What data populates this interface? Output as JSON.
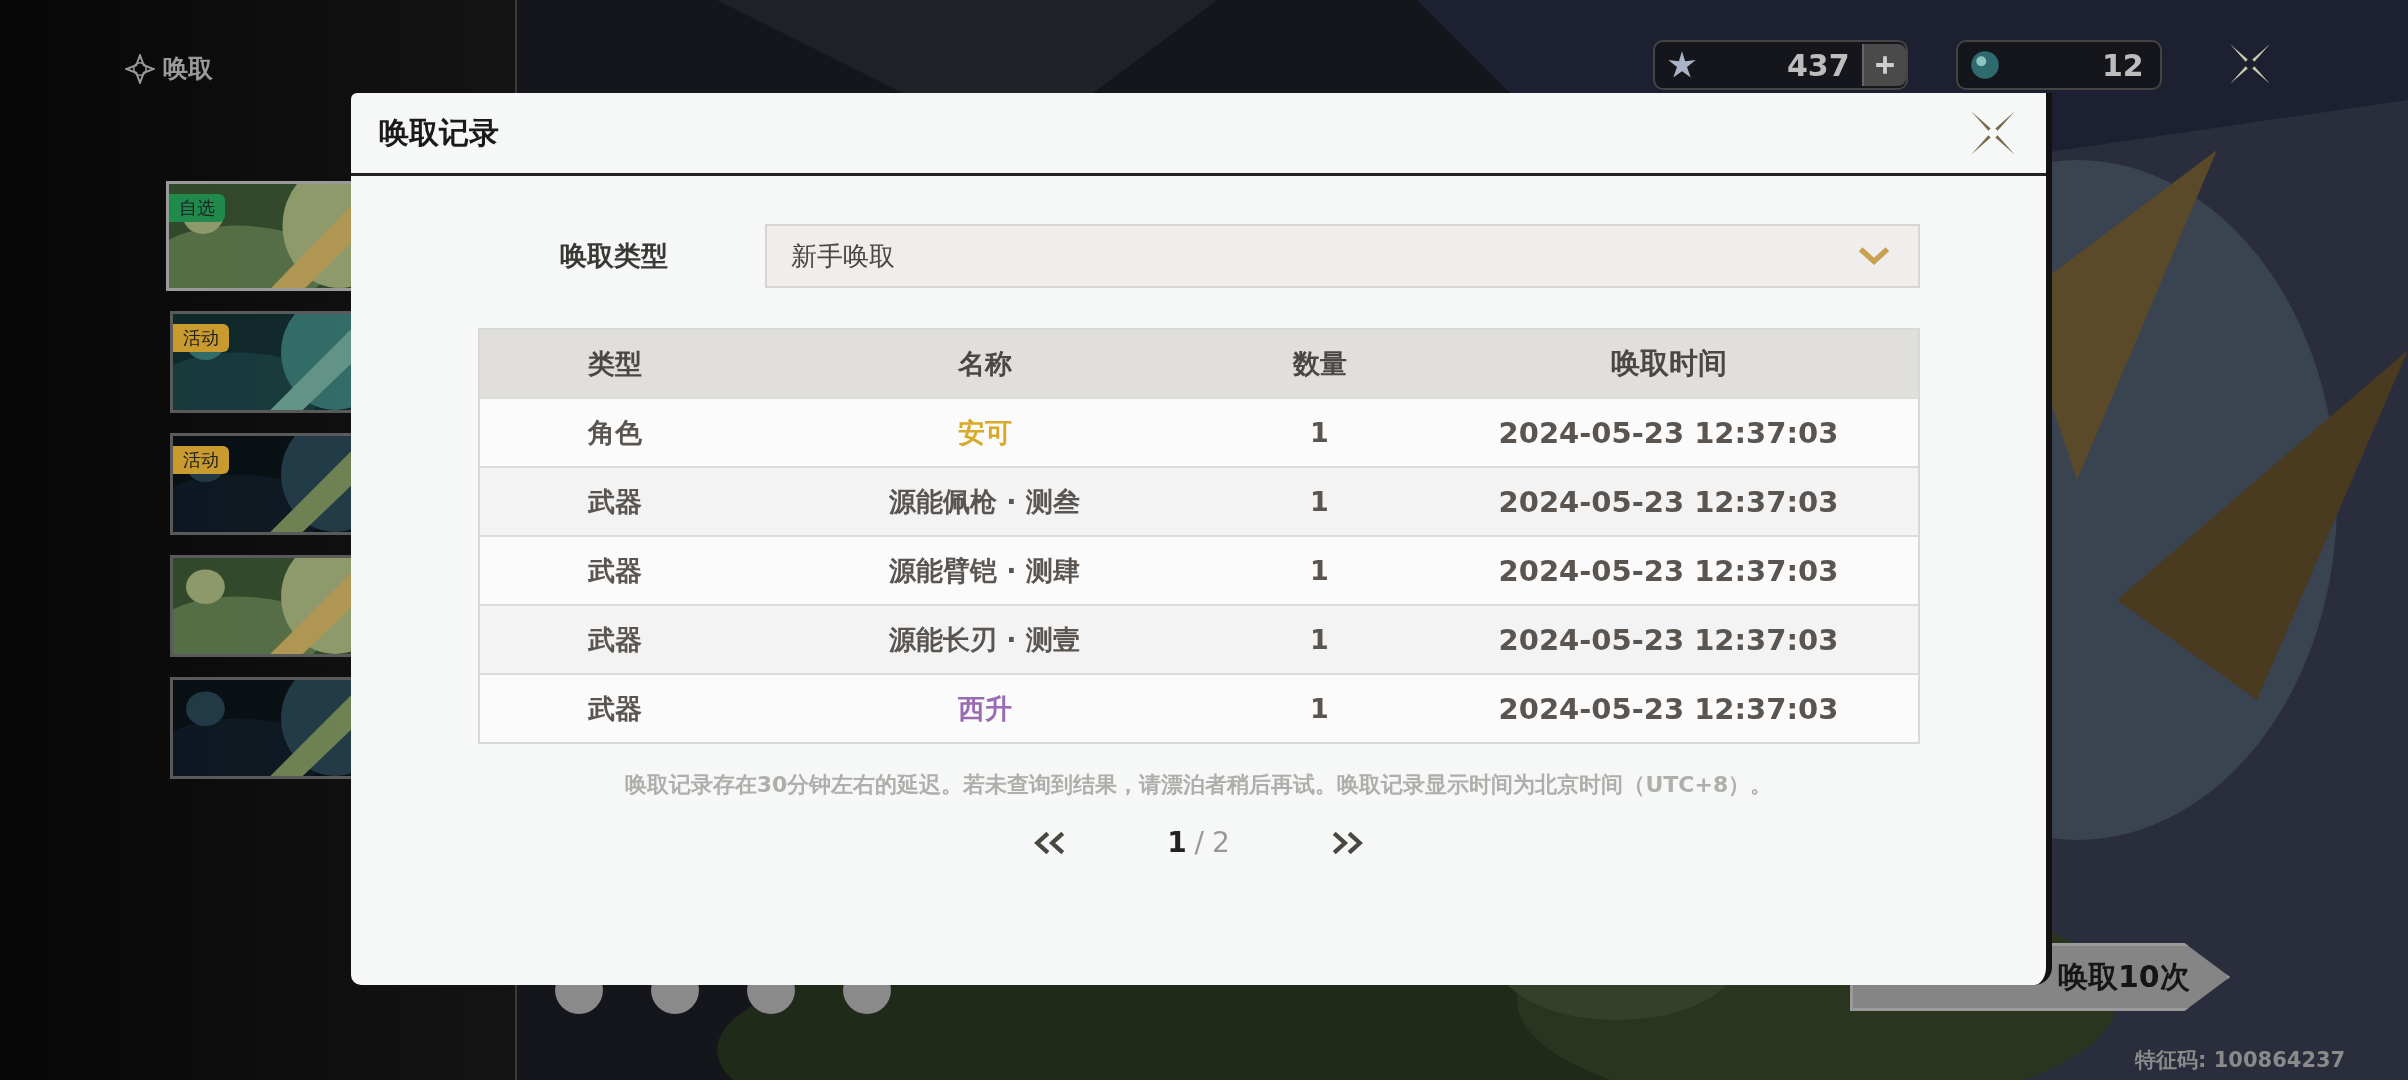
{
  "nav": {
    "title": "唤取"
  },
  "banners": [
    {
      "kind": "picture",
      "tag": "自选",
      "color": "#1f8a4c"
    },
    {
      "kind": "picture",
      "tag": "活动",
      "color": "#c99a2e"
    },
    {
      "kind": "picture",
      "tag": "活动",
      "color": "#c99a2e"
    },
    {
      "kind": "picture"
    },
    {
      "kind": "picture"
    }
  ],
  "currencies": [
    {
      "kind": "star",
      "amount": "437",
      "addable": true
    },
    {
      "kind": "orb",
      "amount": "12",
      "addable": false
    }
  ],
  "pull_button": {
    "label": "唤取10次"
  },
  "feature_code": "特征码: 100864237",
  "modal": {
    "title": "唤取记录",
    "filter": {
      "label": "唤取类型",
      "value": "新手唤取"
    },
    "columns": [
      "类型",
      "名称",
      "数量",
      "唤取时间"
    ],
    "rows": [
      {
        "type": "角色",
        "name": "安可",
        "count": "1",
        "time": "2024-05-23 12:37:03",
        "color": "#d9a92a"
      },
      {
        "type": "武器",
        "name": "源能佩枪 · 测叁",
        "count": "1",
        "time": "2024-05-23 12:37:03",
        "color": "#5a5550"
      },
      {
        "type": "武器",
        "name": "源能臂铠 · 测肆",
        "count": "1",
        "time": "2024-05-23 12:37:03",
        "color": "#5a5550"
      },
      {
        "type": "武器",
        "name": "源能长刃 · 测壹",
        "count": "1",
        "time": "2024-05-23 12:37:03",
        "color": "#5a5550"
      },
      {
        "type": "武器",
        "name": "西升",
        "count": "1",
        "time": "2024-05-23 12:37:03",
        "color": "#9a6bb0"
      }
    ],
    "note": "唤取记录存在30分钟左右的延迟。若未查询到结果，请漂泊者稍后再试。唤取记录显示时间为北京时间（UTC+8）。",
    "pagination": {
      "current": "1",
      "separator": "/",
      "total": "2"
    }
  }
}
